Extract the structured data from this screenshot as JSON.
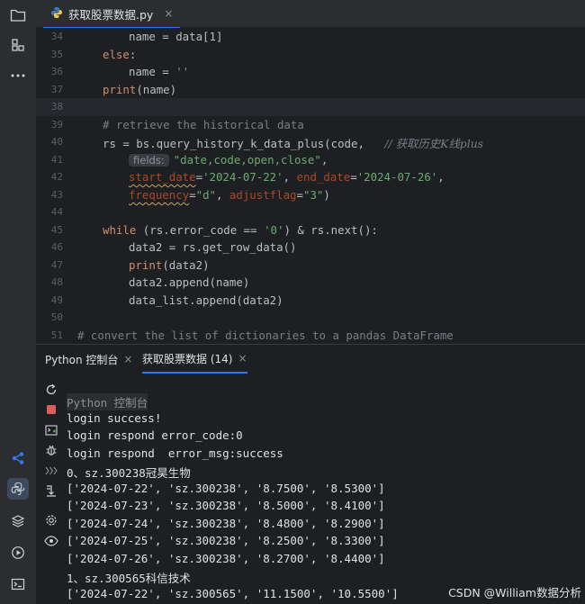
{
  "editor_tab": {
    "filename": "获取股票数据.py",
    "close": "×"
  },
  "gutter": [
    "34",
    "35",
    "36",
    "37",
    "38",
    "39",
    "40",
    "41",
    "42",
    "43",
    "44",
    "45",
    "46",
    "47",
    "48",
    "49",
    "50",
    "51"
  ],
  "code": {
    "l34": "name = data[1]",
    "l35_kw": "else",
    "l35_rest": ":",
    "l36_a": "name = ",
    "l36_str": "''",
    "l37_fn": "print",
    "l37_rest": "(name)",
    "l39": "# retrieve the historical data",
    "l40_a": "rs = bs.query_history_k_data_plus(code,   ",
    "l40_cmt": "// 获取历史K线plus",
    "l41_hint": "fields:",
    "l41_str": "\"date,code,open,close\"",
    "l41_rest": ",",
    "l42_p1": "start_date",
    "l42_eq1": "=",
    "l42_s1": "'2024-07-22'",
    "l42_mid": ", ",
    "l42_p2": "end_date",
    "l42_eq2": "=",
    "l42_s2": "'2024-07-26'",
    "l42_end": ",",
    "l43_p1": "frequency",
    "l43_eq1": "=",
    "l43_s1": "\"d\"",
    "l43_mid": ", ",
    "l43_p2": "adjustflag",
    "l43_eq2": "=",
    "l43_s2": "\"3\"",
    "l43_end": ")",
    "l45_kw": "while",
    "l45_a": " (rs.error_code == ",
    "l45_str": "'0'",
    "l45_b": ") & rs.next():",
    "l46": "data2 = rs.get_row_data()",
    "l47_fn": "print",
    "l47_rest": "(data2)",
    "l48": "data2.append(name)",
    "l49": "data_list.append(data2)",
    "l51": "# convert the list of dictionaries to a pandas DataFrame"
  },
  "console_tabs": {
    "python_console": "Python 控制台",
    "run_tab": "获取股票数据 (14)",
    "close": "×"
  },
  "console_output": [
    "Python 控制台",
    "login success!",
    "login respond error_code:0",
    "login respond  error_msg:success",
    "0、sz.300238冠昊生物",
    "['2024-07-22', 'sz.300238', '8.7500', '8.5300']",
    "['2024-07-23', 'sz.300238', '8.5000', '8.4100']",
    "['2024-07-24', 'sz.300238', '8.4800', '8.2900']",
    "['2024-07-25', 'sz.300238', '8.2500', '8.3300']",
    "['2024-07-26', 'sz.300238', '8.2700', '8.4400']",
    "1、sz.300565科信技术",
    "['2024-07-22', 'sz.300565', '11.1500', '10.5500']"
  ],
  "watermark": "CSDN @William数据分析",
  "colors": {
    "accent": "#3574f0",
    "keyword": "#cf8e6d",
    "string": "#6aab73",
    "comment": "#7a7e85"
  }
}
